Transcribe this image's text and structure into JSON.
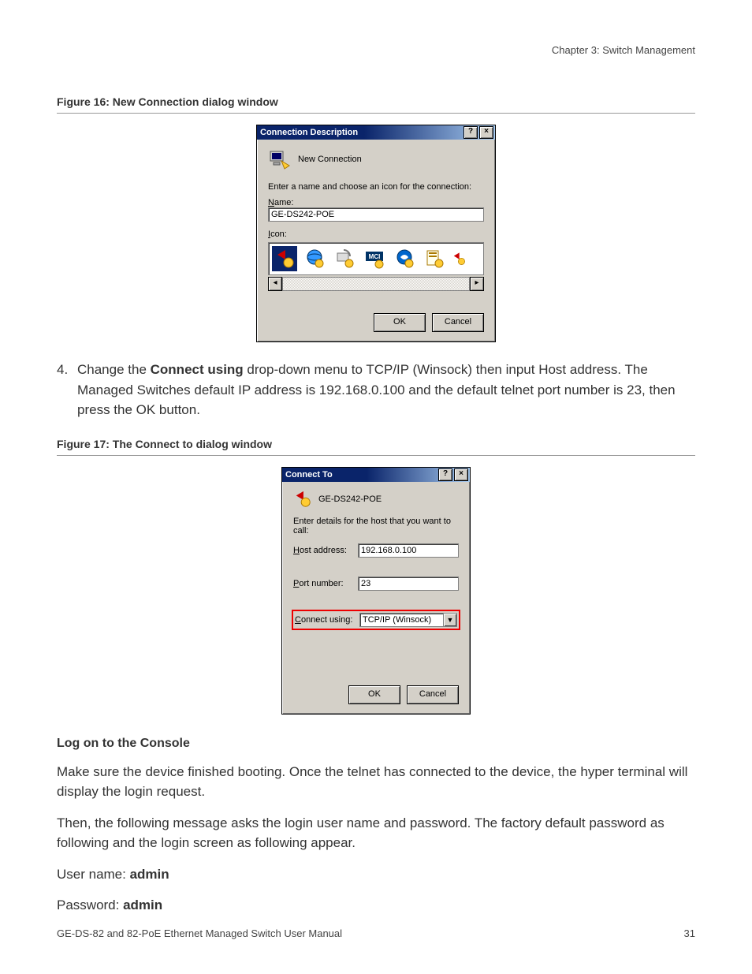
{
  "header": {
    "chapter": "Chapter 3: Switch Management"
  },
  "figure16": {
    "caption": "Figure 16: New Connection dialog window",
    "dialog": {
      "title": "Connection Description",
      "subheader": "New Connection",
      "instruction": "Enter a name and choose an icon for the connection:",
      "name_label": "Name:",
      "name_value": "GE-DS242-POE",
      "icon_label": "Icon:",
      "ok": "OK",
      "cancel": "Cancel"
    }
  },
  "step4": {
    "number": "4.",
    "text_before": "Change the ",
    "bold": "Connect using",
    "text_after": " drop-down menu to TCP/IP (Winsock) then input Host address. The Managed Switches default IP address is 192.168.0.100 and the default telnet port number is 23, then press the OK button."
  },
  "figure17": {
    "caption": "Figure 17: The Connect to dialog window",
    "dialog": {
      "title": "Connect To",
      "conn_name": "GE-DS242-POE",
      "instruction": "Enter details for the host that you want to call:",
      "host_label": "Host address:",
      "host_value": "192.168.0.100",
      "port_label": "Port number:",
      "port_value": "23",
      "connect_label": "Connect using:",
      "connect_value": "TCP/IP (Winsock)",
      "ok": "OK",
      "cancel": "Cancel"
    }
  },
  "section": {
    "heading": "Log on to the Console",
    "para1": "Make sure the device finished booting. Once the telnet has connected to the device, the hyper terminal will display the login request.",
    "para2": "Then, the following message asks the login user name and password. The factory default password as following and the login screen as following appear.",
    "user_label": "User name: ",
    "user_value": "admin",
    "pass_label": "Password: ",
    "pass_value": "admin"
  },
  "footer": {
    "left": "GE-DS-82 and 82-PoE Ethernet Managed Switch User Manual",
    "right": "31"
  }
}
